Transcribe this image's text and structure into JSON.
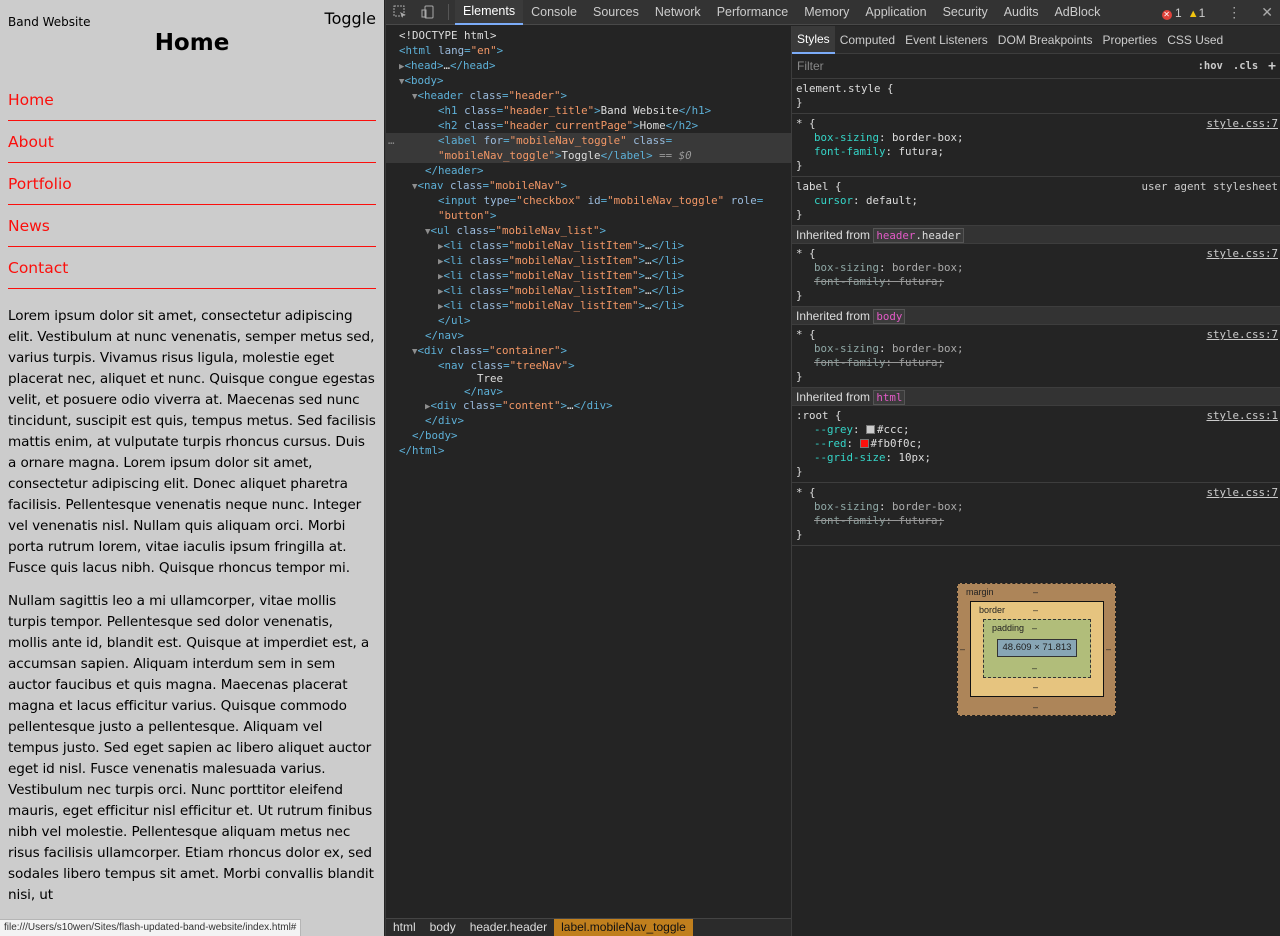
{
  "site": {
    "title": "Band Website",
    "toggle": "Toggle",
    "current_page": "Home",
    "nav": [
      "Home",
      "About",
      "Portfolio",
      "News",
      "Contact"
    ],
    "paragraphs": [
      "Lorem ipsum dolor sit amet, consectetur adipiscing elit. Vestibulum at nunc venenatis, semper metus sed, varius turpis. Vivamus risus ligula, molestie eget placerat nec, aliquet et nunc. Quisque congue egestas velit, et posuere odio viverra at. Maecenas sed nunc tincidunt, suscipit est quis, tempus metus. Sed facilisis mattis enim, at vulputate turpis rhoncus cursus. Duis a ornare magna. Lorem ipsum dolor sit amet, consectetur adipiscing elit. Donec aliquet pharetra facilisis. Pellentesque venenatis neque nunc. Integer vel venenatis nisl. Nullam quis aliquam orci. Morbi porta rutrum lorem, vitae iaculis ipsum fringilla at. Fusce quis lacus nibh. Quisque rhoncus tempor mi.",
      "Nullam sagittis leo a mi ullamcorper, vitae mollis turpis tempor. Pellentesque sed dolor venenatis, mollis ante id, blandit est. Quisque at imperdiet est, a accumsan sapien. Aliquam interdum sem in sem auctor faucibus et quis magna. Maecenas placerat magna et lacus efficitur varius. Quisque commodo pellentesque justo a pellentesque. Aliquam vel tempus justo. Sed eget sapien ac libero aliquet auctor eget id nisl. Fusce venenatis malesuada varius. Vestibulum nec turpis orci. Nunc porttitor eleifend mauris, eget efficitur nisl efficitur et. Ut rutrum finibus nibh vel molestie. Pellentesque aliquam metus nec risus facilisis ullamcorper. Etiam rhoncus dolor ex, sed sodales libero tempus sit amet. Morbi convallis blandit nisi, ut"
    ],
    "status_url": "file:///Users/s10wen/Sites/flash-updated-band-website/index.html#"
  },
  "devtools": {
    "tabs": [
      "Elements",
      "Console",
      "Sources",
      "Network",
      "Performance",
      "Memory",
      "Application",
      "Security",
      "Audits",
      "AdBlock"
    ],
    "active_tab": "Elements",
    "error_count": "1",
    "warning_count": "1",
    "elements": {
      "doctype": "<!DOCTYPE html>",
      "html_tag": "html",
      "lang_attr": "lang",
      "lang_val": "\"en\"",
      "head": "head",
      "body": "body",
      "header_tag": "header",
      "class_attr": "class",
      "header_class": "\"header\"",
      "h1_tag": "h1",
      "h1_class": "\"header_title\"",
      "h1_text": "Band Website",
      "h2_tag": "h2",
      "h2_class": "\"header_currentPage\"",
      "h2_text": "Home",
      "label_tag": "label",
      "for_attr": "for",
      "label_for": "\"mobileNav_toggle\"",
      "label_class": "\"mobileNav_toggle\"",
      "label_text": "Toggle",
      "selected_marker": "== $0",
      "nav_tag": "nav",
      "nav_class": "\"mobileNav\"",
      "input_tag": "input",
      "type_attr": "type",
      "input_type": "\"checkbox\"",
      "id_attr": "id",
      "input_id": "\"mobileNav_toggle\"",
      "role_attr": "role",
      "input_role": "\"button\"",
      "ul_tag": "ul",
      "ul_class": "\"mobileNav_list\"",
      "li_tag": "li",
      "li_class": "\"mobileNav_listItem\"",
      "div_tag": "div",
      "container_class": "\"container\"",
      "treenav_class": "\"treeNav\"",
      "tree_text": "Tree",
      "content_class": "\"content\"",
      "ellipsis": "…"
    },
    "breadcrumbs": [
      "html",
      "body",
      "header.header",
      "label.mobileNav_toggle"
    ],
    "styles": {
      "tabs": [
        "Styles",
        "Computed",
        "Event Listeners",
        "DOM Breakpoints",
        "Properties",
        "CSS Used"
      ],
      "filter_placeholder": "Filter",
      "hov": ":hov",
      "cls": ".cls",
      "plus": "+",
      "element_style": "element.style {",
      "star": "* {",
      "label_sel": "label {",
      "root_sel": ":root {",
      "close": "}",
      "src_7": "style.css:7",
      "src_1": "style.css:1",
      "ua": "user agent stylesheet",
      "box_sizing": "box-sizing",
      "border_box": "border-box;",
      "font_family": "font-family",
      "futura": "futura;",
      "cursor": "cursor",
      "default": "default;",
      "inherited_from": "Inherited from",
      "inh_header": "header",
      "inh_header_cls": ".header",
      "inh_body": "body",
      "inh_html": "html",
      "grey": "--grey",
      "grey_val": "#ccc;",
      "red": "--red",
      "red_val": "#fb0f0c;",
      "grid": "--grid-size",
      "grid_val": "10px;"
    },
    "box_model": {
      "margin": "margin",
      "border": "border",
      "padding": "padding",
      "content": "48.609 × 71.813",
      "dash": "–"
    }
  },
  "colors": {
    "accent_red": "#fb0f0c",
    "grey": "#cccccc"
  }
}
